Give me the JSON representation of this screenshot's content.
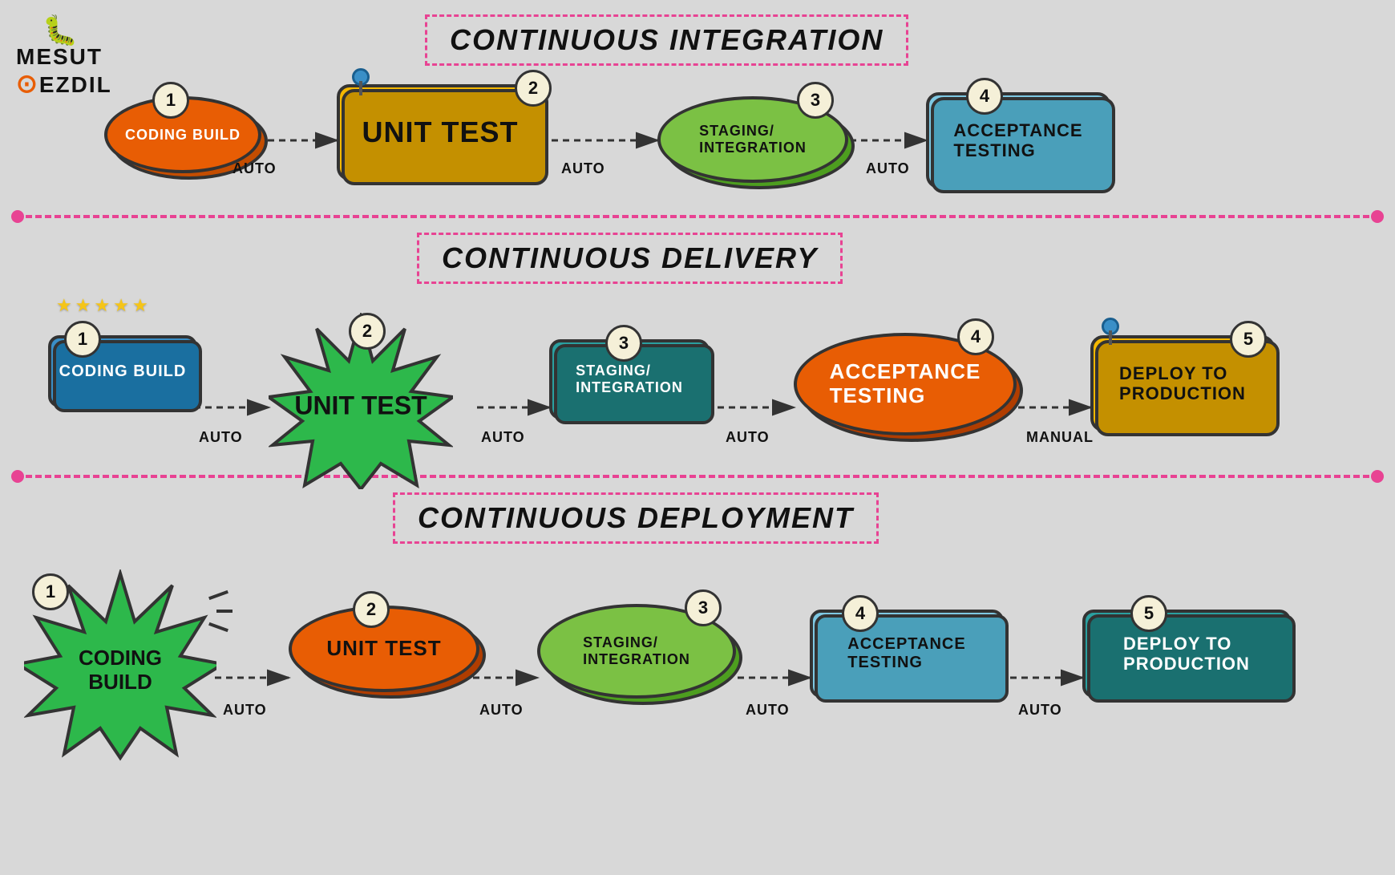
{
  "logo": {
    "bug_icon": "🐞",
    "line1": "MESUT",
    "dot": "⊙",
    "line2": "EZDIL"
  },
  "sections": {
    "ci": {
      "title": "CONTINUOUS INTEGRATION",
      "steps": [
        {
          "num": "1",
          "label": "CODING BUILD",
          "shape": "oval",
          "color": "#e85d04"
        },
        {
          "num": "2",
          "label": "UNIT TEST",
          "shape": "rect",
          "color": "#f5b800"
        },
        {
          "num": "3",
          "label": "STAGING/\nINTEGRATION",
          "shape": "oval",
          "color": "#7bc144"
        },
        {
          "num": "4",
          "label": "ACCEPTANCE\nTESTING",
          "shape": "rect",
          "color": "#7ec8e3"
        }
      ],
      "arrows": [
        "AUTO",
        "AUTO",
        "AUTO"
      ]
    },
    "cd": {
      "title": "CONTINUOUS DELIVERY",
      "steps": [
        {
          "num": "1",
          "label": "CODING BUILD",
          "shape": "rect",
          "color": "#3a8fc7"
        },
        {
          "num": "2",
          "label": "UNIT TEST",
          "shape": "burst",
          "color": "#2db84b"
        },
        {
          "num": "3",
          "label": "STAGING/\nINTEGRATION",
          "shape": "rect",
          "color": "#2aa0a0"
        },
        {
          "num": "4",
          "label": "ACCEPTANCE\nTESTING",
          "shape": "oval",
          "color": "#e85d04"
        },
        {
          "num": "5",
          "label": "DEPLOY TO\nPRODUCTION",
          "shape": "rect",
          "color": "#f5b800"
        }
      ],
      "arrows": [
        "AUTO",
        "AUTO",
        "AUTO",
        "MANUAL"
      ]
    },
    "cdeploy": {
      "title": "CONTINUOUS DEPLOYMENT",
      "steps": [
        {
          "num": "1",
          "label": "CODING\nBUILD",
          "shape": "burst",
          "color": "#2db84b"
        },
        {
          "num": "2",
          "label": "UNIT TEST",
          "shape": "oval",
          "color": "#e85d04"
        },
        {
          "num": "3",
          "label": "STAGING/\nINTEGRATION",
          "shape": "oval",
          "color": "#7bc144"
        },
        {
          "num": "4",
          "label": "ACCEPTANCE\nTESTING",
          "shape": "rect",
          "color": "#7ec8e3"
        },
        {
          "num": "5",
          "label": "DEPLOY TO\nPRODUCTION",
          "shape": "rect",
          "color": "#2aa0a0"
        }
      ],
      "arrows": [
        "AUTO",
        "AUTO",
        "AUTO",
        "AUTO"
      ]
    }
  }
}
